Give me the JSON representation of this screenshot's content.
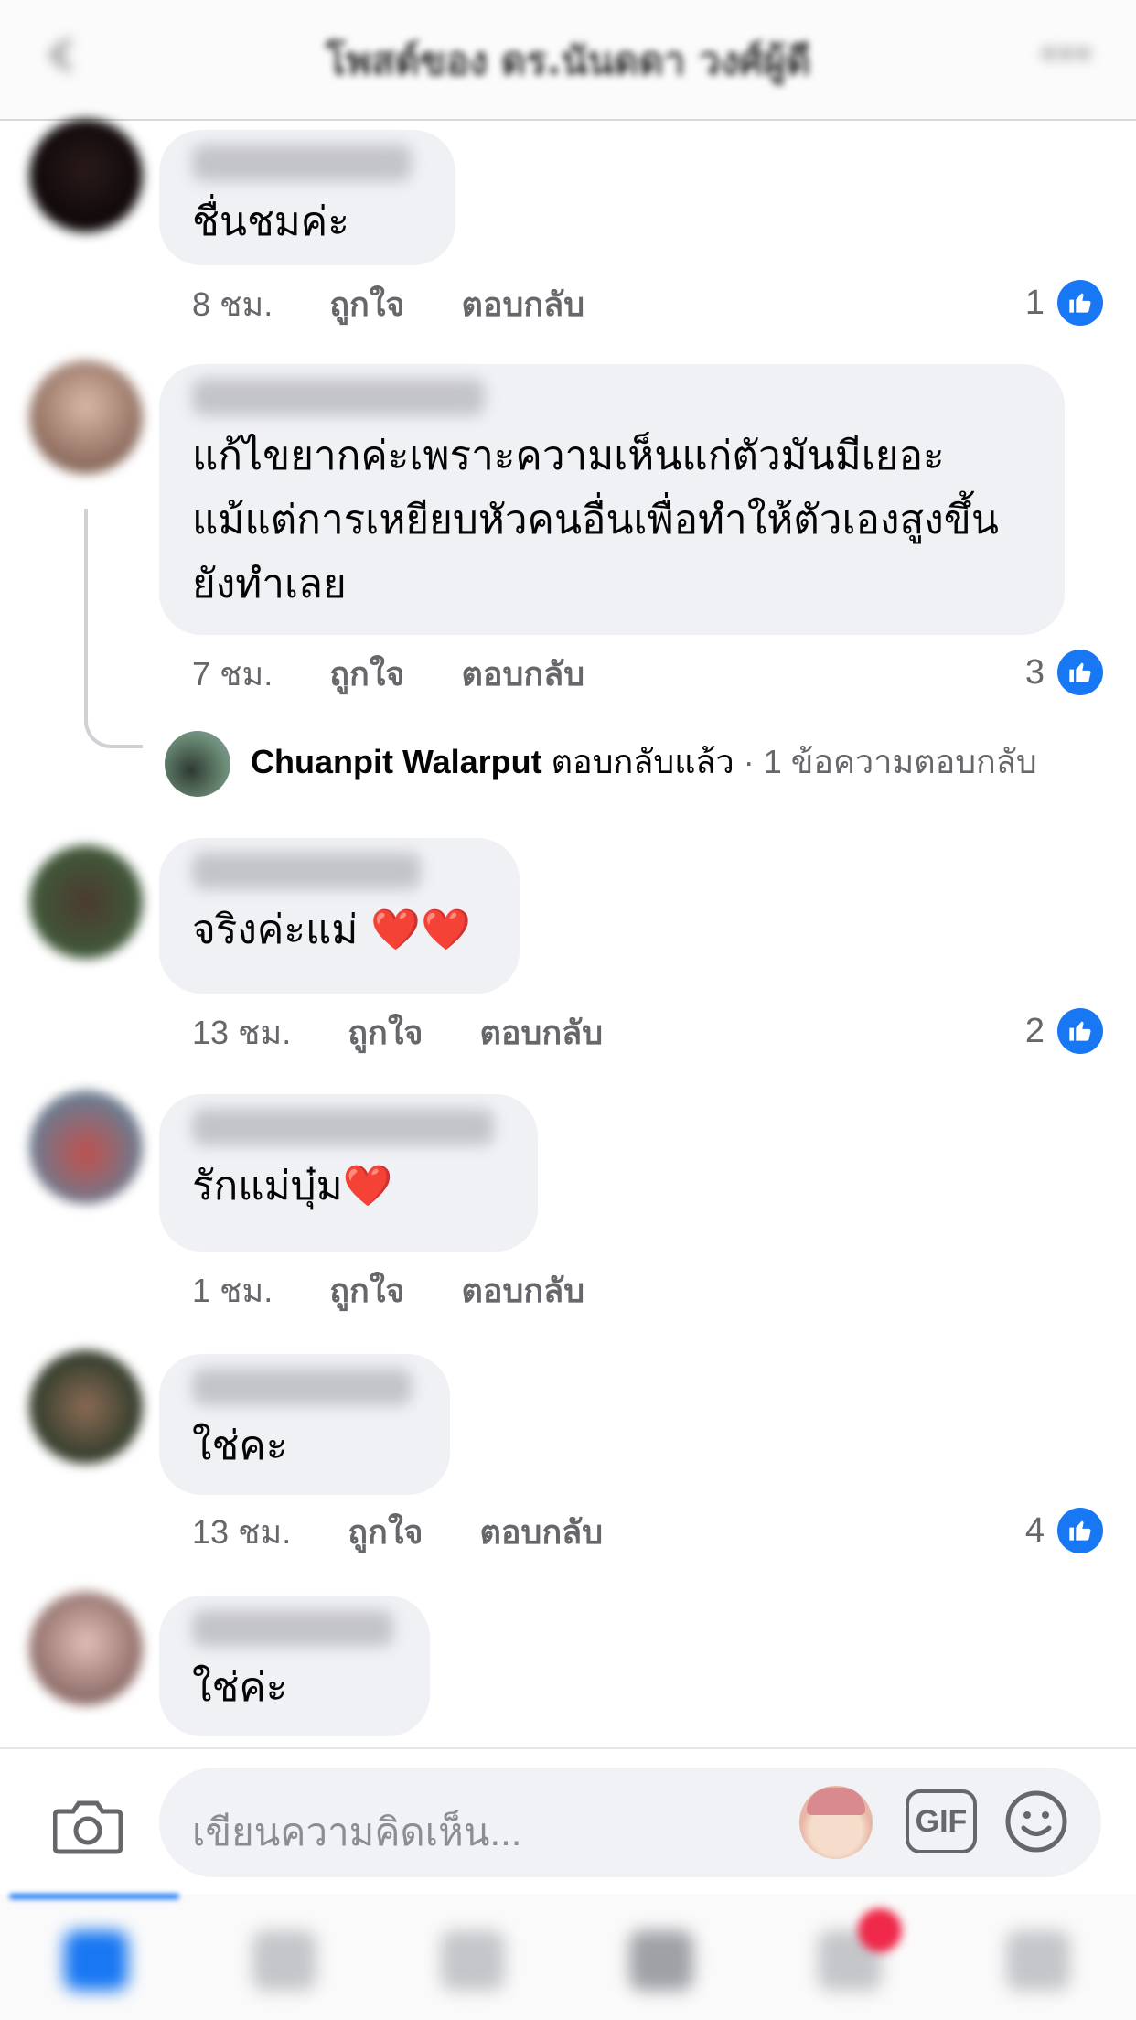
{
  "header": {
    "title": "โพสต์ของ ดร.นันดดา วงศ์ผู้ดี"
  },
  "comments": [
    {
      "text": "ชื่นชมค่ะ",
      "time": "8 ชม.",
      "like_label": "ถูกใจ",
      "reply_label": "ตอบกลับ",
      "likes": "1"
    },
    {
      "text": "แก้ไขยากค่ะเพราะความเห็นแก่ตัวมันมีเยอะ\nแม้แต่การเหยียบหัวคนอื่นเพื่อทำให้ตัวเองสูงขึ้น\nยังทำเลย",
      "time": "7 ชม.",
      "like_label": "ถูกใจ",
      "reply_label": "ตอบกลับ",
      "likes": "3"
    },
    {
      "text": "จริงค่ะแม่ ❤️❤️",
      "time": "13 ชม.",
      "like_label": "ถูกใจ",
      "reply_label": "ตอบกลับ",
      "likes": "2"
    },
    {
      "text": "รักแม่บุ๋ม❤️",
      "time": "1 ชม.",
      "like_label": "ถูกใจ",
      "reply_label": "ตอบกลับ",
      "likes": ""
    },
    {
      "text": "ใช่คะ",
      "time": "13 ชม.",
      "like_label": "ถูกใจ",
      "reply_label": "ตอบกลับ",
      "likes": "4"
    },
    {
      "text": "ใช่ค่ะ"
    }
  ],
  "reply_summary": {
    "name": "Chuanpit Walarput",
    "action": "ตอบกลับแล้ว",
    "count_text": "· 1 ข้อความตอบกลับ"
  },
  "composer": {
    "placeholder": "เขียนความคิดเห็น...",
    "gif_label": "GIF"
  },
  "colors": {
    "accent": "#1877f2",
    "bubble": "#f0f1f5",
    "muted": "#65676b"
  },
  "icons": [
    "back-icon",
    "more-icon",
    "like-icon",
    "camera-icon",
    "gif-icon",
    "smile-icon",
    "home-tab-icon"
  ]
}
